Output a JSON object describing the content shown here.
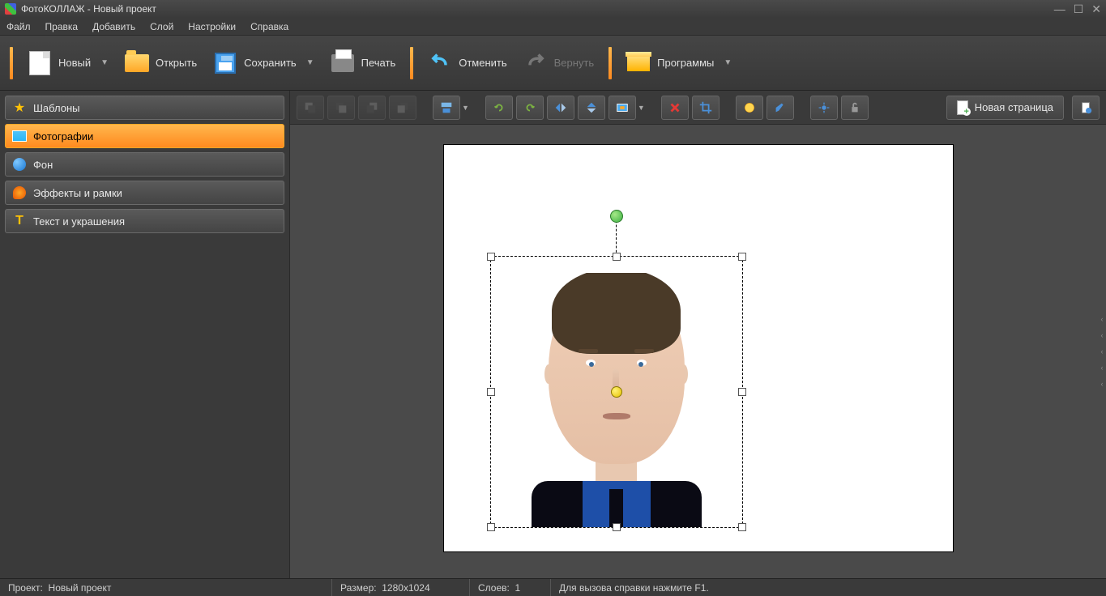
{
  "window": {
    "title": "ФотоКОЛЛАЖ - Новый проект"
  },
  "menubar": {
    "file": "Файл",
    "edit": "Правка",
    "insert": "Добавить",
    "layer": "Слой",
    "settings": "Настройки",
    "help": "Справка"
  },
  "toolbar": {
    "new": "Новый",
    "open": "Открыть",
    "save": "Сохранить",
    "print": "Печать",
    "undo": "Отменить",
    "redo": "Вернуть",
    "programs": "Программы"
  },
  "sidetabs": {
    "templates": "Шаблоны",
    "photos": "Фотографии",
    "background": "Фон",
    "effects": "Эффекты и рамки",
    "text": "Текст и украшения"
  },
  "newpage": "Новая страница",
  "status": {
    "project_label": "Проект:",
    "project_value": "Новый проект",
    "size_label": "Размер:",
    "size_value": "1280x1024",
    "layers_label": "Слоев:",
    "layers_value": "1",
    "help_hint": "Для вызова справки нажмите F1."
  }
}
